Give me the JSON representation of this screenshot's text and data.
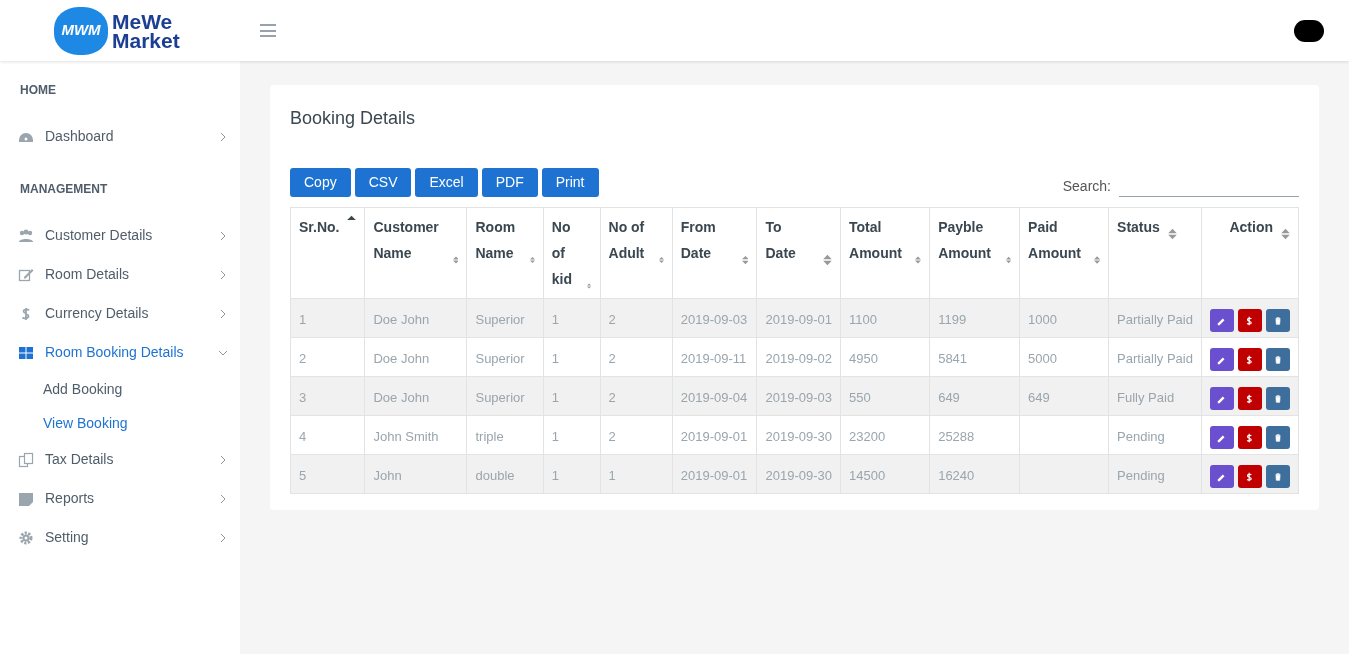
{
  "header": {
    "logo_mark": "MWM",
    "logo_text": [
      "MeWe",
      "Market"
    ]
  },
  "sidebar": {
    "sections": [
      {
        "heading": "HOME",
        "items": [
          {
            "label": "Dashboard",
            "selected": false,
            "expanded": false
          }
        ]
      },
      {
        "heading": "MANAGEMENT",
        "items": [
          {
            "label": "Customer Details",
            "selected": false,
            "expanded": false
          },
          {
            "label": "Room Details",
            "selected": false,
            "expanded": false
          },
          {
            "label": "Currency Details",
            "selected": false,
            "expanded": false
          },
          {
            "label": "Room Booking Details",
            "selected": true,
            "expanded": true,
            "children": [
              {
                "label": "Add Booking",
                "selected": false
              },
              {
                "label": "View Booking",
                "selected": true
              }
            ]
          },
          {
            "label": "Tax Details",
            "selected": false,
            "expanded": false
          },
          {
            "label": "Reports",
            "selected": false,
            "expanded": false
          },
          {
            "label": "Setting",
            "selected": false,
            "expanded": false
          }
        ]
      }
    ]
  },
  "card": {
    "title": "Booking Details",
    "export_buttons": [
      "Copy",
      "CSV",
      "Excel",
      "PDF",
      "Print"
    ],
    "search": {
      "label": "Search:"
    },
    "table": {
      "columns": [
        {
          "label": "Sr.No.",
          "sorted": true
        },
        {
          "label": "Customer Name",
          "sorted": false
        },
        {
          "label": "Room Name",
          "sorted": false
        },
        {
          "label": "No of kid",
          "sorted": false
        },
        {
          "label": "No of Adult",
          "sorted": false
        },
        {
          "label": "From Date",
          "sorted": false
        },
        {
          "label": "To Date",
          "sorted": false
        },
        {
          "label": "Total Amount",
          "sorted": false
        },
        {
          "label": "Payble Amount",
          "sorted": false
        },
        {
          "label": "Paid Amount",
          "sorted": false
        },
        {
          "label": "Status",
          "sorted": false
        },
        {
          "label": "Action",
          "sorted": false
        }
      ],
      "rows": [
        {
          "cells": [
            "1",
            "Doe John",
            "Superior",
            "1",
            "2",
            "2019-09-03",
            "2019-09-01",
            "1100",
            "1199",
            "1000",
            "Partially Paid"
          ]
        },
        {
          "cells": [
            "2",
            "Doe John",
            "Superior",
            "1",
            "2",
            "2019-09-11",
            "2019-09-02",
            "4950",
            "5841",
            "5000",
            "Partially Paid"
          ]
        },
        {
          "cells": [
            "3",
            "Doe John",
            "Superior",
            "1",
            "2",
            "2019-09-04",
            "2019-09-03",
            "550",
            "649",
            "649",
            "Fully Paid"
          ]
        },
        {
          "cells": [
            "4",
            "John Smith",
            "triple",
            "1",
            "2",
            "2019-09-01",
            "2019-09-30",
            "23200",
            "25288",
            "",
            "Pending"
          ]
        },
        {
          "cells": [
            "5",
            "John",
            "double",
            "1",
            "1",
            "2019-09-01",
            "2019-09-30",
            "14500",
            "16240",
            "",
            "Pending"
          ]
        }
      ]
    }
  }
}
